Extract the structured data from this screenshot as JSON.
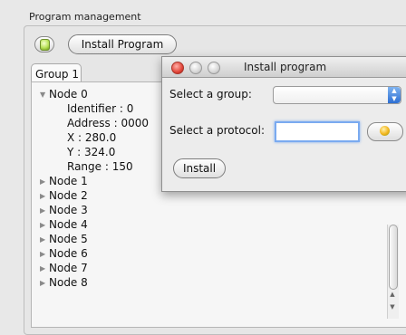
{
  "panel": {
    "title": "Program management",
    "install_program_label": "Install Program"
  },
  "tabs": [
    {
      "label": "Group 1"
    }
  ],
  "tree": {
    "node0": {
      "label": "Node 0",
      "expanded": true,
      "details": [
        "Identifier : 0",
        "Address : 0000",
        "X : 280.0",
        "Y : 324.0",
        "Range : 150"
      ]
    },
    "nodes": [
      "Node 1",
      "Node 2",
      "Node 3",
      "Node 4",
      "Node 5",
      "Node 6",
      "Node 7",
      "Node 8"
    ]
  },
  "dialog": {
    "title": "Install program",
    "group_label": "Select a group:",
    "group_value": "",
    "protocol_label": "Select a protocol:",
    "protocol_value": "",
    "install_label": "Install"
  },
  "icons": {
    "tree_expanded": "▼",
    "tree_collapsed": "▶",
    "select_arrows": "▲▼"
  }
}
